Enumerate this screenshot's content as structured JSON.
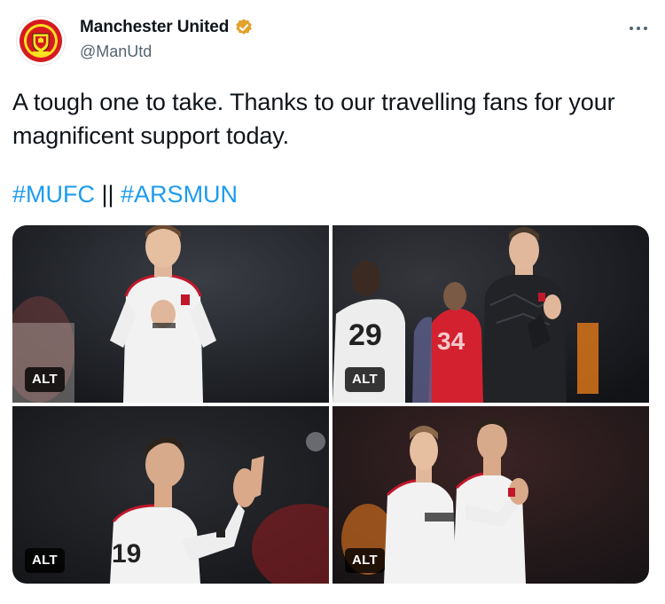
{
  "author": {
    "display_name": "Manchester United",
    "handle": "@ManUtd",
    "avatar_icon": "manchester-united-crest",
    "verified_badge_icon": "verified-badge-icon",
    "verified_color": "#e2a22b"
  },
  "menu": {
    "icon": "more-options-icon"
  },
  "tweet": {
    "text": "A tough one to take. Thanks to our travelling fans for your magnificent support today.",
    "hashtags": [
      "#MUFC",
      "#ARSMUN"
    ],
    "separator": " || "
  },
  "media": {
    "photos": [
      {
        "subject": "player-applauding-white-kit",
        "alt_label": "ALT"
      },
      {
        "subject": "goalkeeper-applauding-dark-kit",
        "alt_label": "ALT"
      },
      {
        "subject": "player-applauding-side-view",
        "alt_label": "ALT"
      },
      {
        "subject": "two-players-applauding",
        "alt_label": "ALT"
      }
    ]
  },
  "colors": {
    "text": "#0f1419",
    "secondary_text": "#536471",
    "link": "#1d9bf0",
    "kit_white": "#f2f2f2",
    "kit_red_trim": "#c0172b"
  }
}
